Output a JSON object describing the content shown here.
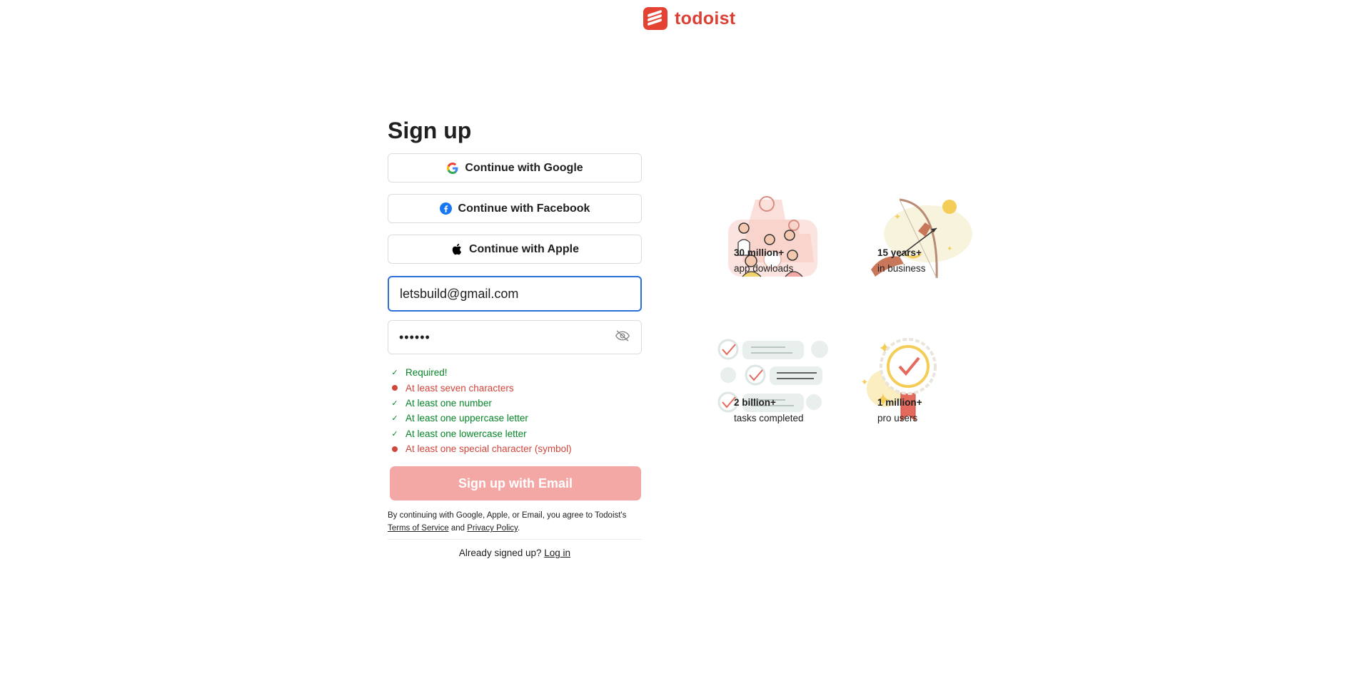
{
  "brand": {
    "name": "todoist",
    "color": "#db4035"
  },
  "form": {
    "title": "Sign up",
    "social": [
      {
        "label": "Continue with Google",
        "icon": "google-icon"
      },
      {
        "label": "Continue with Facebook",
        "icon": "facebook-icon"
      },
      {
        "label": "Continue with Apple",
        "icon": "apple-icon"
      }
    ],
    "email_value": "letsbuild@gmail.com",
    "password_mask": "••••••",
    "rules": [
      {
        "text": "Required!",
        "status": "ok"
      },
      {
        "text": "At least seven characters",
        "status": "fail"
      },
      {
        "text": "At least one number",
        "status": "ok"
      },
      {
        "text": "At least one uppercase letter",
        "status": "ok"
      },
      {
        "text": "At least one lowercase letter",
        "status": "ok"
      },
      {
        "text": "At least one special character (symbol)",
        "status": "fail"
      }
    ],
    "submit_label": "Sign up with Email",
    "legal": {
      "prefix": "By continuing with Google, Apple, or Email, you agree to Todoist's",
      "terms": "Terms of Service",
      "and": "and",
      "privacy": "Privacy Policy",
      "suffix": "."
    },
    "login_prompt": "Already signed up?",
    "login_link": "Log in"
  },
  "stats": [
    {
      "number": "30 million+",
      "label": "app dowloads"
    },
    {
      "number": "15 years+",
      "label": "in business"
    },
    {
      "number": "2 billion+",
      "label": "tasks completed"
    },
    {
      "number": "1 million+",
      "label": "pro users"
    }
  ],
  "colors": {
    "ok": "#058527",
    "fail": "#d1453b",
    "focus": "#2a6fdb",
    "submit_disabled": "#f3a8a6"
  }
}
